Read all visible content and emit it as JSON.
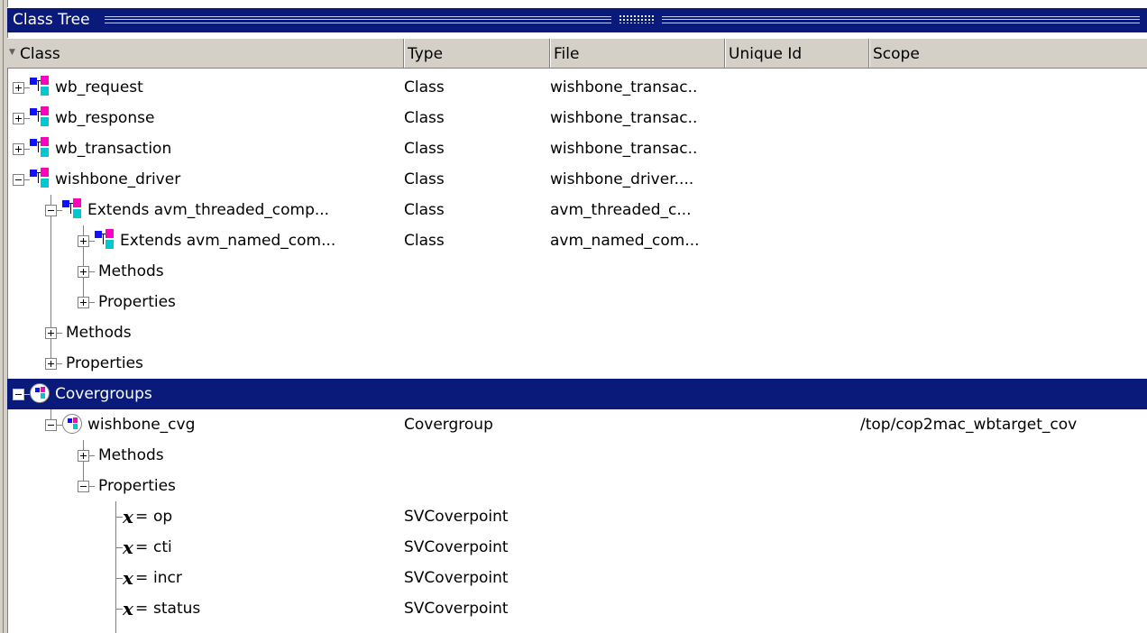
{
  "window": {
    "title": "Class Tree"
  },
  "columns": {
    "class": "Class",
    "type": "Type",
    "file": "File",
    "unique_id": "Unique Id",
    "scope": "Scope"
  },
  "rows": [
    {
      "name": "wb_request",
      "type": "Class",
      "file": "wishbone_transac..",
      "scope": "",
      "expander": "plus",
      "icon": "class-icon",
      "level": 0
    },
    {
      "name": "wb_response",
      "type": "Class",
      "file": "wishbone_transac..",
      "scope": "",
      "expander": "plus",
      "icon": "class-icon",
      "level": 0
    },
    {
      "name": "wb_transaction",
      "type": "Class",
      "file": "wishbone_transac..",
      "scope": "",
      "expander": "plus",
      "icon": "class-icon",
      "level": 0
    },
    {
      "name": "wishbone_driver",
      "type": "Class",
      "file": "wishbone_driver....",
      "scope": "",
      "expander": "minus",
      "icon": "class-icon",
      "level": 0
    },
    {
      "name": "Extends  avm_threaded_comp...",
      "type": "Class",
      "file": "avm_threaded_c...",
      "scope": "",
      "expander": "minus",
      "icon": "class-icon",
      "level": 1
    },
    {
      "name": "Extends  avm_named_com...",
      "type": "Class",
      "file": "avm_named_com...",
      "scope": "",
      "expander": "plus",
      "icon": "class-icon",
      "level": 2
    },
    {
      "name": "Methods",
      "type": "",
      "file": "",
      "scope": "",
      "expander": "plus",
      "icon": "",
      "level": 2
    },
    {
      "name": "Properties",
      "type": "",
      "file": "",
      "scope": "",
      "expander": "plus",
      "icon": "",
      "level": 2
    },
    {
      "name": "Methods",
      "type": "",
      "file": "",
      "scope": "",
      "expander": "plus",
      "icon": "",
      "level": 1
    },
    {
      "name": "Properties",
      "type": "",
      "file": "",
      "scope": "",
      "expander": "plus",
      "icon": "",
      "level": 1
    },
    {
      "name": "Covergroups",
      "type": "",
      "file": "",
      "scope": "",
      "expander": "minus",
      "icon": "covergroup-icon",
      "level": 0,
      "selected": true
    },
    {
      "name": "wishbone_cvg",
      "type": "Covergroup",
      "file": "",
      "scope": "/top/cop2mac_wbtarget_cov",
      "expander": "minus",
      "icon": "covergroup-icon",
      "level": 1
    },
    {
      "name": "Methods",
      "type": "",
      "file": "",
      "scope": "",
      "expander": "plus",
      "icon": "",
      "level": 2
    },
    {
      "name": "Properties",
      "type": "",
      "file": "",
      "scope": "",
      "expander": "minus",
      "icon": "",
      "level": 2
    },
    {
      "name": "op",
      "type": "SVCoverpoint",
      "file": "",
      "scope": "",
      "expander": "",
      "icon": "variable-icon",
      "level": 3
    },
    {
      "name": "cti",
      "type": "SVCoverpoint",
      "file": "",
      "scope": "",
      "expander": "",
      "icon": "variable-icon",
      "level": 3
    },
    {
      "name": "incr",
      "type": "SVCoverpoint",
      "file": "",
      "scope": "",
      "expander": "",
      "icon": "variable-icon",
      "level": 3
    },
    {
      "name": "status",
      "type": "SVCoverpoint",
      "file": "",
      "scope": "",
      "expander": "",
      "icon": "variable-icon",
      "level": 3
    }
  ],
  "variable_icon": {
    "glyph": "x",
    "suffix": "="
  },
  "colors": {
    "selection": "#0a1a7a",
    "titlebar": "#0a1a7a",
    "header": "#d4d0c8"
  }
}
